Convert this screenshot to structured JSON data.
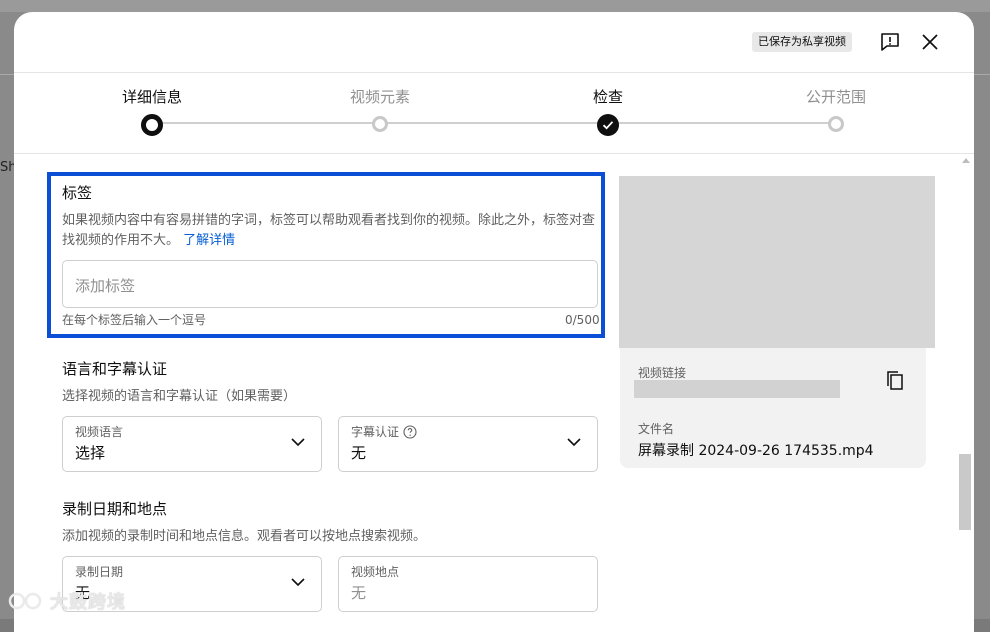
{
  "background": {
    "peek_text": "Sh"
  },
  "header": {
    "save_status": "已保存为私享视频"
  },
  "steps": [
    {
      "label": "详细信息",
      "state": "current"
    },
    {
      "label": "视频元素",
      "state": "pending"
    },
    {
      "label": "检查",
      "state": "done"
    },
    {
      "label": "公开范围",
      "state": "pending"
    }
  ],
  "tags": {
    "title": "标签",
    "description": "如果视频内容中有容易拼错的字词，标签可以帮助观看者找到你的视频。除此之外，标签对查找视频的作用不大。",
    "learn_more": "了解详情",
    "placeholder": "添加标签",
    "hint": "在每个标签后输入一个逗号",
    "counter": "0/500"
  },
  "language": {
    "title": "语言和字幕认证",
    "description": "选择视频的语言和字幕认证（如果需要）",
    "video_language": {
      "label": "视频语言",
      "value": "选择"
    },
    "caption_cert": {
      "label": "字幕认证",
      "value": "无"
    }
  },
  "recording": {
    "title": "录制日期和地点",
    "description": "添加视频的录制时间和地点信息。观看者可以按地点搜索视频。",
    "date": {
      "label": "录制日期",
      "value": "无"
    },
    "location": {
      "label": "视频地点",
      "placeholder": "无"
    }
  },
  "side_panel": {
    "link_label": "视频链接",
    "file_label": "文件名",
    "filename": "屏幕录制 2024-09-26 174535.mp4"
  },
  "watermark": "大鼓跨境",
  "colors": {
    "highlight": "#0a4fd6",
    "link": "#065fd4"
  }
}
